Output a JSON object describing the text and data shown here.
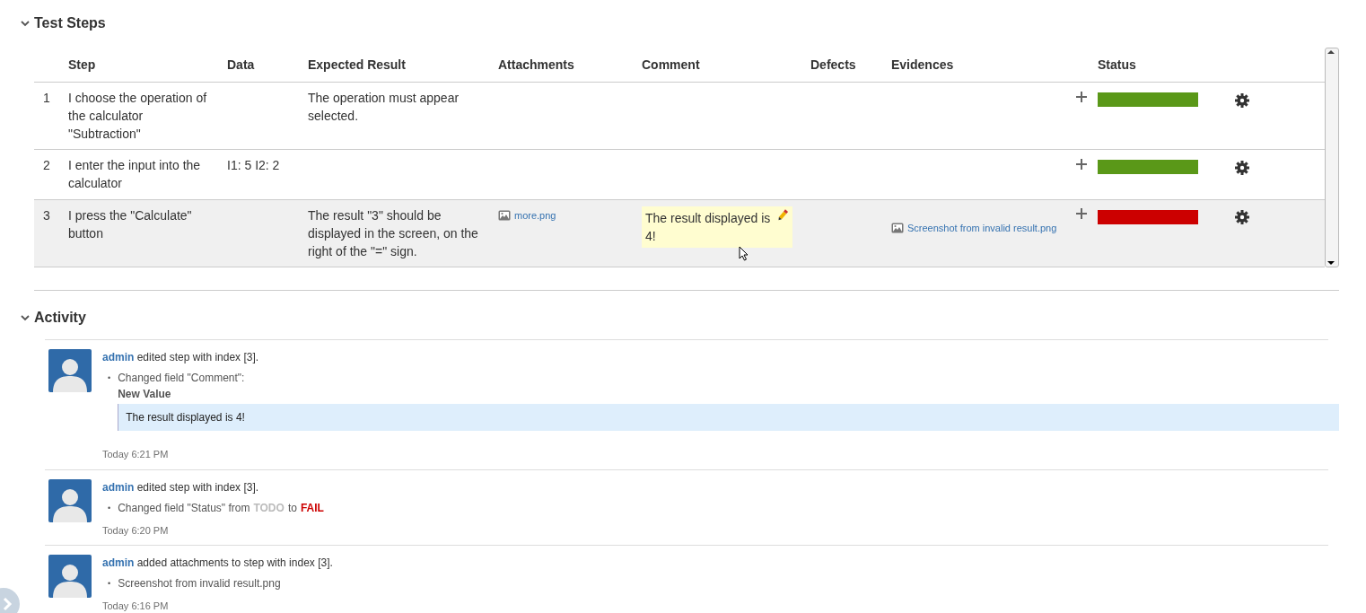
{
  "test_steps": {
    "title": "Test Steps",
    "expanded": true,
    "columns": [
      "Step",
      "Data",
      "Expected Result",
      "Attachments",
      "Comment",
      "Defects",
      "Evidences",
      "Status"
    ],
    "rows": [
      {
        "index": "1",
        "step": "I choose the operation of the calculator \"Subtraction\"",
        "data": "",
        "expected": "The operation must appear selected.",
        "attachments": [],
        "comment": "",
        "evidences": [],
        "color": "#5a9818",
        "selected": false
      },
      {
        "index": "2",
        "step": "I enter the input into the calculator",
        "data": "I1: 5 I2: 2",
        "expected": "",
        "attachments": [],
        "comment": "",
        "evidences": [],
        "color": "#5a9818",
        "selected": false
      },
      {
        "index": "3",
        "step": "I press the \"Calculate\" button",
        "data": "",
        "expected": "The result \"3\" should be displayed in the screen, on the right of the \"=\" sign.",
        "attachments": [
          "more.png"
        ],
        "comment": "The result displayed is 4!",
        "evidences": [
          "Screenshot from invalid result.png"
        ],
        "color": "#cc0000",
        "selected": true
      }
    ]
  },
  "activity": {
    "title": "Activity",
    "expanded": true,
    "items": [
      {
        "user": "admin",
        "action": "edited step with index [3].",
        "time": "Today 6:21 PM",
        "changes": [
          {
            "kind": "value",
            "bullet": "•",
            "text": "Changed field \"Comment\":",
            "label": "New Value",
            "value": "The result displayed is 4!"
          }
        ]
      },
      {
        "user": "admin",
        "action": "edited step with index [3].",
        "time": "Today 6:20 PM",
        "changes": [
          {
            "kind": "status",
            "bullet": "•",
            "text": "Changed field \"Status\" from",
            "states": [
              {
                "text": "TODO",
                "color": "#bbbbbb"
              },
              {
                "text": "FAIL",
                "color": "#cc0000"
              }
            ],
            "joiner": "to"
          }
        ]
      },
      {
        "user": "admin",
        "action": "added attachments to step with index [3].",
        "time": "Today 6:16 PM",
        "changes": [
          {
            "kind": "plain",
            "bullet": "•",
            "text": "Screenshot from invalid result.png"
          }
        ]
      }
    ]
  }
}
